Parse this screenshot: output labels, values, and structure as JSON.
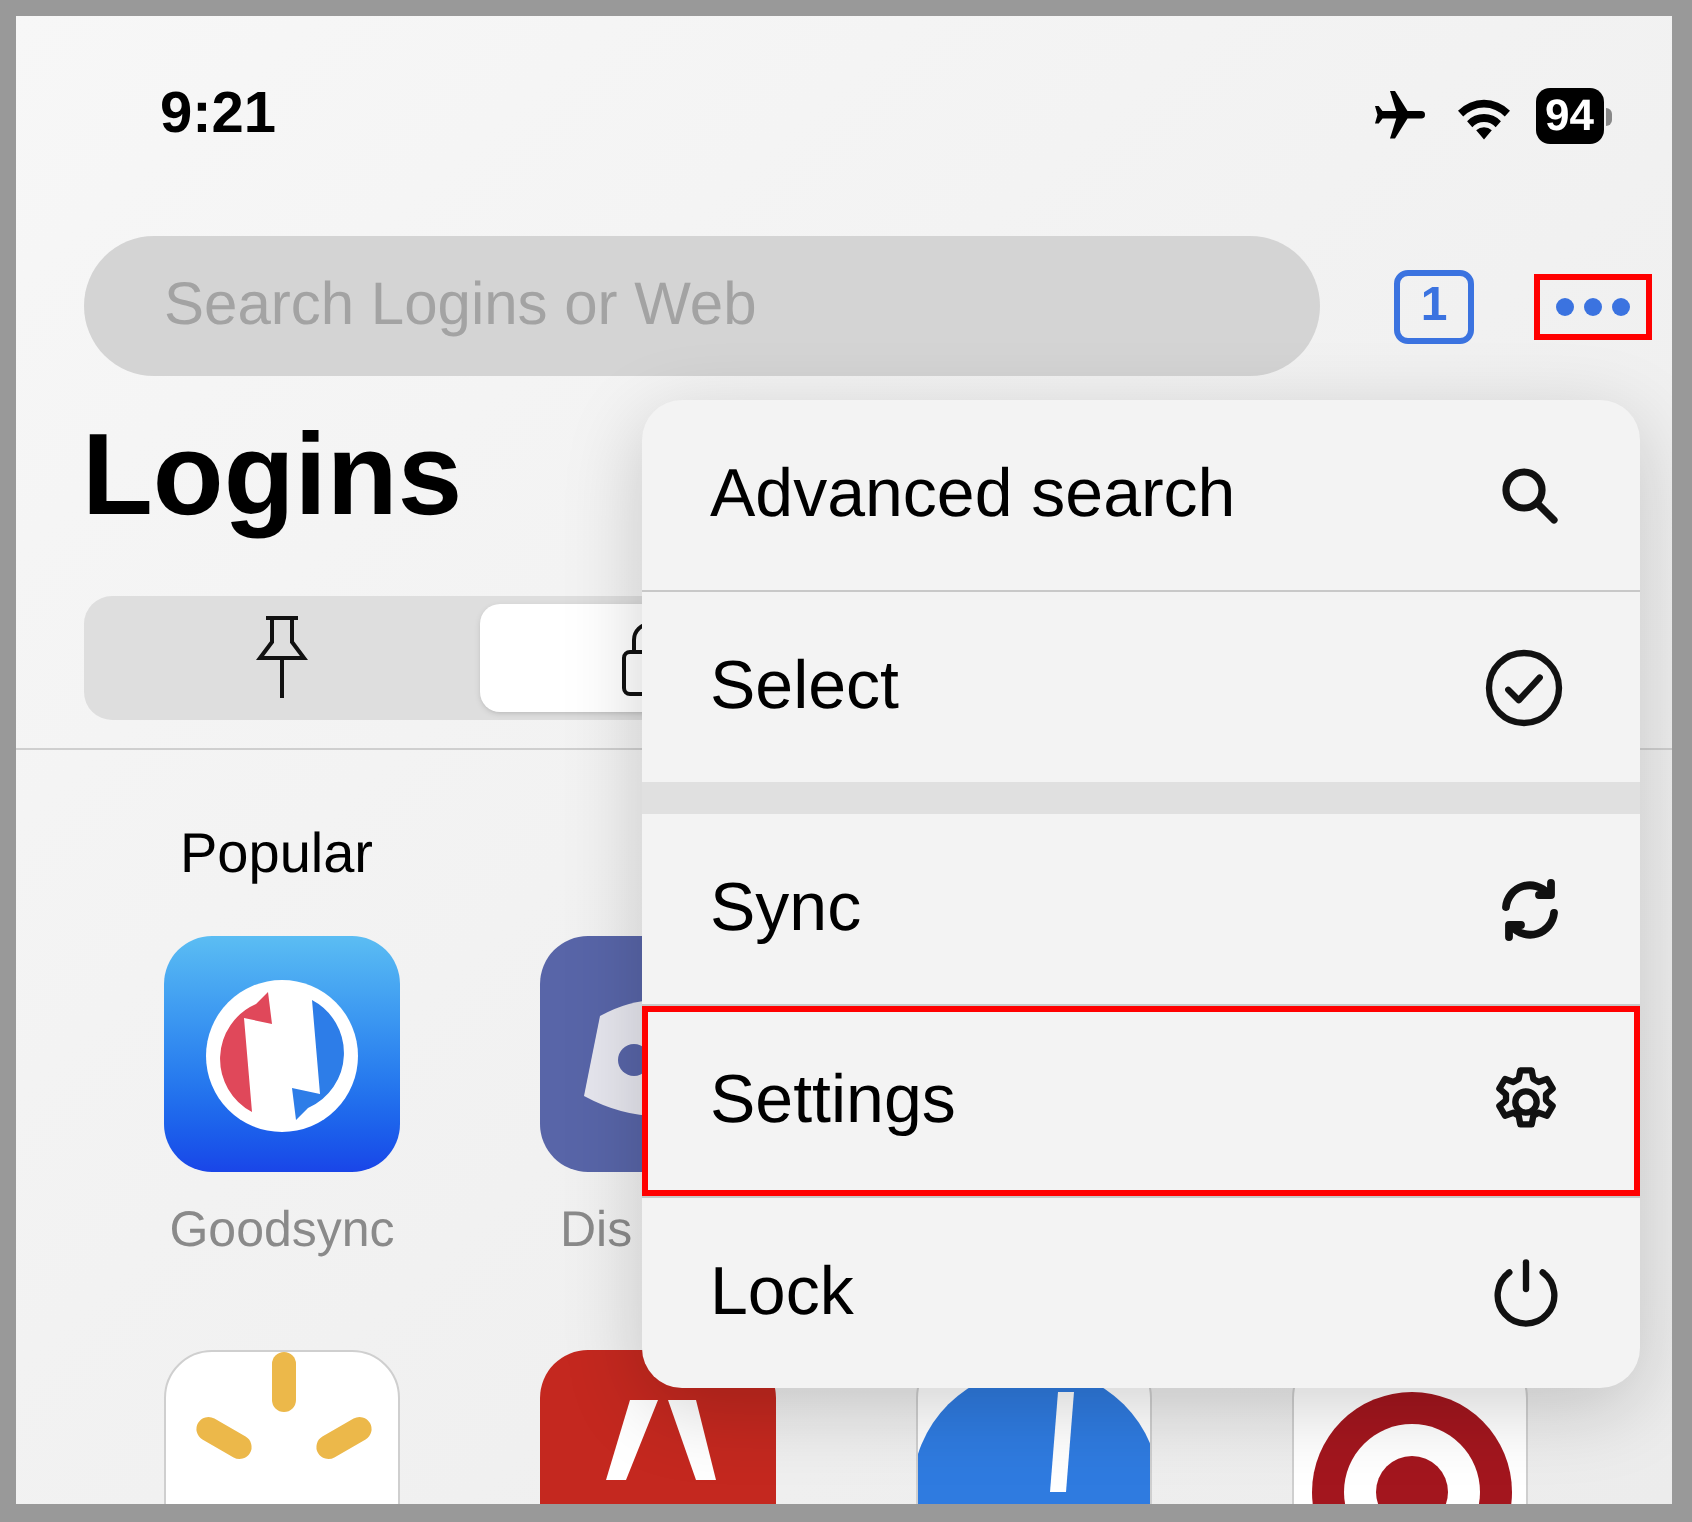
{
  "status_bar": {
    "time": "9:21",
    "battery": "94"
  },
  "search": {
    "placeholder": "Search Logins or Web"
  },
  "tab_count": "1",
  "more_button": {
    "highlighted": true
  },
  "title": "Logins",
  "segments": [
    {
      "kind": "pin",
      "selected": false
    },
    {
      "kind": "lock",
      "selected": true
    }
  ],
  "section": {
    "title": "Popular",
    "rows": [
      [
        {
          "kind": "goodsync",
          "label": "Goodsync"
        },
        {
          "kind": "discord",
          "label": "Dis"
        }
      ],
      [
        {
          "kind": "spark"
        },
        {
          "kind": "red"
        },
        {
          "kind": "blue"
        },
        {
          "kind": "target"
        }
      ]
    ]
  },
  "menu": {
    "groups": [
      [
        {
          "kind": "search",
          "label": "Advanced search",
          "highlighted": false
        },
        {
          "kind": "check",
          "label": "Select",
          "highlighted": false
        }
      ],
      [
        {
          "kind": "sync",
          "label": "Sync",
          "highlighted": false
        },
        {
          "kind": "settings",
          "label": "Settings",
          "highlighted": true
        },
        {
          "kind": "power",
          "label": "Lock",
          "highlighted": false
        }
      ]
    ]
  }
}
